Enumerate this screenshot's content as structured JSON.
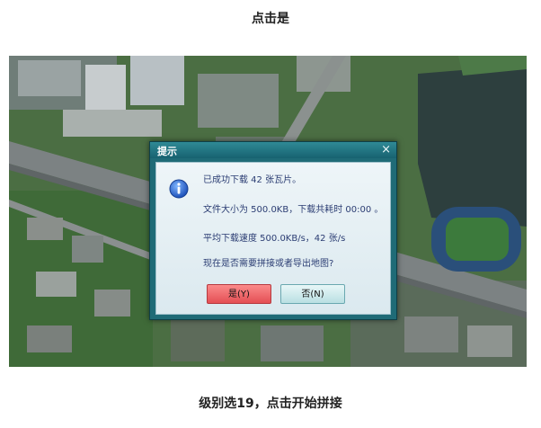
{
  "captions": {
    "top": "点击是",
    "bottom": "级别选19，点击开始拼接"
  },
  "dialog": {
    "title": "提示",
    "close_glyph": "×",
    "icon": "info-icon",
    "messages": [
      "已成功下载 42 张瓦片。",
      "文件大小为 500.0KB，下载共耗时 00:00 。",
      "平均下载速度 500.0KB/s，42 张/s",
      "现在是否需要拼接或者导出地图?"
    ],
    "buttons": {
      "yes_label": "是(Y)",
      "no_label": "否(N)"
    }
  },
  "colors": {
    "dialog_frame": "#1f6b77",
    "yes_button": "#e44f54",
    "no_button": "#b9dfe2",
    "message_text": "#2b3d73"
  }
}
